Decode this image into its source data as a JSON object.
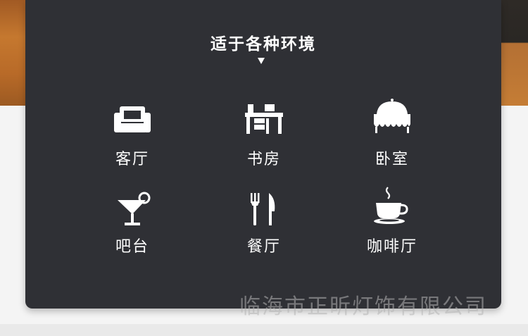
{
  "title": "适于各种环境",
  "items": [
    {
      "label": "客厅",
      "icon": "sofa-icon"
    },
    {
      "label": "书房",
      "icon": "desk-icon"
    },
    {
      "label": "卧室",
      "icon": "bed-icon"
    },
    {
      "label": "吧台",
      "icon": "cocktail-glass-icon"
    },
    {
      "label": "餐厅",
      "icon": "fork-knife-icon"
    },
    {
      "label": "咖啡厅",
      "icon": "coffee-cup-icon"
    }
  ],
  "watermark": "临海市正昕灯饰有限公司",
  "colors": {
    "panel": "#2f3035",
    "text": "#ffffff"
  }
}
